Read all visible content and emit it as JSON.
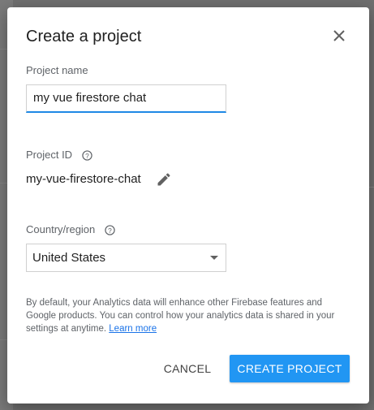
{
  "dialog": {
    "title": "Create a project",
    "project_name": {
      "label": "Project name",
      "value": "my vue firestore chat"
    },
    "project_id": {
      "label": "Project ID",
      "value": "my-vue-firestore-chat"
    },
    "country": {
      "label": "Country/region",
      "selected": "United States"
    },
    "disclaimer": {
      "text": "By default, your Analytics data will enhance other Firebase features and Google products. You can control how your analytics data is shared in your settings at anytime.",
      "link_text": "Learn more"
    },
    "buttons": {
      "cancel": "CANCEL",
      "create": "CREATE PROJECT"
    }
  },
  "colors": {
    "accent": "#2196f3",
    "input_underline": "#1e88e5",
    "link": "#1a73e8",
    "overlay": "#6f6f6f"
  },
  "icons": {
    "close": "close-icon",
    "help": "help-circle-icon",
    "edit": "pencil-icon",
    "dropdown": "chevron-down-icon"
  }
}
